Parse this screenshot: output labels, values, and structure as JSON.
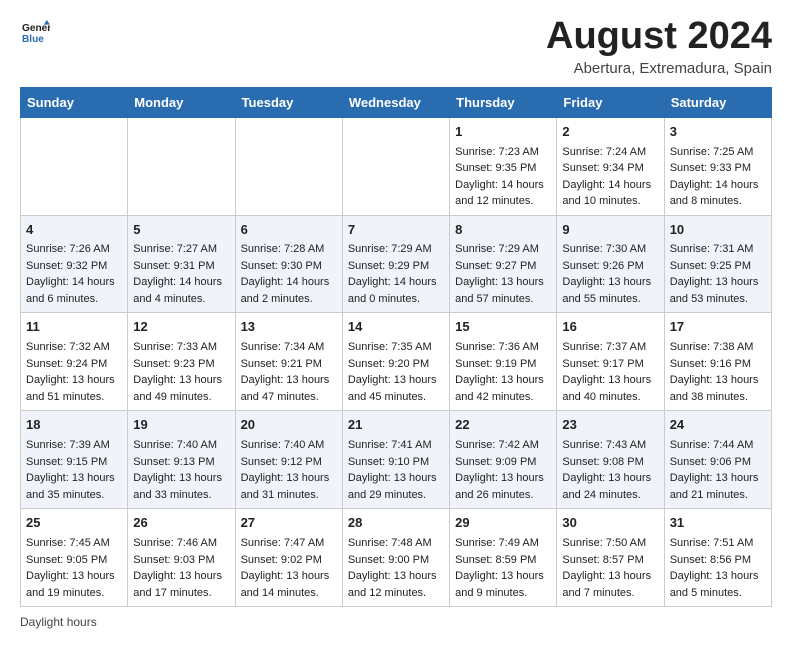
{
  "header": {
    "logo_general": "General",
    "logo_blue": "Blue",
    "title": "August 2024",
    "subtitle": "Abertura, Extremadura, Spain"
  },
  "weekdays": [
    "Sunday",
    "Monday",
    "Tuesday",
    "Wednesday",
    "Thursday",
    "Friday",
    "Saturday"
  ],
  "weeks": [
    [
      {
        "day": "",
        "info": ""
      },
      {
        "day": "",
        "info": ""
      },
      {
        "day": "",
        "info": ""
      },
      {
        "day": "",
        "info": ""
      },
      {
        "day": "1",
        "info": "Sunrise: 7:23 AM\nSunset: 9:35 PM\nDaylight: 14 hours\nand 12 minutes."
      },
      {
        "day": "2",
        "info": "Sunrise: 7:24 AM\nSunset: 9:34 PM\nDaylight: 14 hours\nand 10 minutes."
      },
      {
        "day": "3",
        "info": "Sunrise: 7:25 AM\nSunset: 9:33 PM\nDaylight: 14 hours\nand 8 minutes."
      }
    ],
    [
      {
        "day": "4",
        "info": "Sunrise: 7:26 AM\nSunset: 9:32 PM\nDaylight: 14 hours\nand 6 minutes."
      },
      {
        "day": "5",
        "info": "Sunrise: 7:27 AM\nSunset: 9:31 PM\nDaylight: 14 hours\nand 4 minutes."
      },
      {
        "day": "6",
        "info": "Sunrise: 7:28 AM\nSunset: 9:30 PM\nDaylight: 14 hours\nand 2 minutes."
      },
      {
        "day": "7",
        "info": "Sunrise: 7:29 AM\nSunset: 9:29 PM\nDaylight: 14 hours\nand 0 minutes."
      },
      {
        "day": "8",
        "info": "Sunrise: 7:29 AM\nSunset: 9:27 PM\nDaylight: 13 hours\nand 57 minutes."
      },
      {
        "day": "9",
        "info": "Sunrise: 7:30 AM\nSunset: 9:26 PM\nDaylight: 13 hours\nand 55 minutes."
      },
      {
        "day": "10",
        "info": "Sunrise: 7:31 AM\nSunset: 9:25 PM\nDaylight: 13 hours\nand 53 minutes."
      }
    ],
    [
      {
        "day": "11",
        "info": "Sunrise: 7:32 AM\nSunset: 9:24 PM\nDaylight: 13 hours\nand 51 minutes."
      },
      {
        "day": "12",
        "info": "Sunrise: 7:33 AM\nSunset: 9:23 PM\nDaylight: 13 hours\nand 49 minutes."
      },
      {
        "day": "13",
        "info": "Sunrise: 7:34 AM\nSunset: 9:21 PM\nDaylight: 13 hours\nand 47 minutes."
      },
      {
        "day": "14",
        "info": "Sunrise: 7:35 AM\nSunset: 9:20 PM\nDaylight: 13 hours\nand 45 minutes."
      },
      {
        "day": "15",
        "info": "Sunrise: 7:36 AM\nSunset: 9:19 PM\nDaylight: 13 hours\nand 42 minutes."
      },
      {
        "day": "16",
        "info": "Sunrise: 7:37 AM\nSunset: 9:17 PM\nDaylight: 13 hours\nand 40 minutes."
      },
      {
        "day": "17",
        "info": "Sunrise: 7:38 AM\nSunset: 9:16 PM\nDaylight: 13 hours\nand 38 minutes."
      }
    ],
    [
      {
        "day": "18",
        "info": "Sunrise: 7:39 AM\nSunset: 9:15 PM\nDaylight: 13 hours\nand 35 minutes."
      },
      {
        "day": "19",
        "info": "Sunrise: 7:40 AM\nSunset: 9:13 PM\nDaylight: 13 hours\nand 33 minutes."
      },
      {
        "day": "20",
        "info": "Sunrise: 7:40 AM\nSunset: 9:12 PM\nDaylight: 13 hours\nand 31 minutes."
      },
      {
        "day": "21",
        "info": "Sunrise: 7:41 AM\nSunset: 9:10 PM\nDaylight: 13 hours\nand 29 minutes."
      },
      {
        "day": "22",
        "info": "Sunrise: 7:42 AM\nSunset: 9:09 PM\nDaylight: 13 hours\nand 26 minutes."
      },
      {
        "day": "23",
        "info": "Sunrise: 7:43 AM\nSunset: 9:08 PM\nDaylight: 13 hours\nand 24 minutes."
      },
      {
        "day": "24",
        "info": "Sunrise: 7:44 AM\nSunset: 9:06 PM\nDaylight: 13 hours\nand 21 minutes."
      }
    ],
    [
      {
        "day": "25",
        "info": "Sunrise: 7:45 AM\nSunset: 9:05 PM\nDaylight: 13 hours\nand 19 minutes."
      },
      {
        "day": "26",
        "info": "Sunrise: 7:46 AM\nSunset: 9:03 PM\nDaylight: 13 hours\nand 17 minutes."
      },
      {
        "day": "27",
        "info": "Sunrise: 7:47 AM\nSunset: 9:02 PM\nDaylight: 13 hours\nand 14 minutes."
      },
      {
        "day": "28",
        "info": "Sunrise: 7:48 AM\nSunset: 9:00 PM\nDaylight: 13 hours\nand 12 minutes."
      },
      {
        "day": "29",
        "info": "Sunrise: 7:49 AM\nSunset: 8:59 PM\nDaylight: 13 hours\nand 9 minutes."
      },
      {
        "day": "30",
        "info": "Sunrise: 7:50 AM\nSunset: 8:57 PM\nDaylight: 13 hours\nand 7 minutes."
      },
      {
        "day": "31",
        "info": "Sunrise: 7:51 AM\nSunset: 8:56 PM\nDaylight: 13 hours\nand 5 minutes."
      }
    ]
  ],
  "footer": {
    "daylight_label": "Daylight hours"
  }
}
